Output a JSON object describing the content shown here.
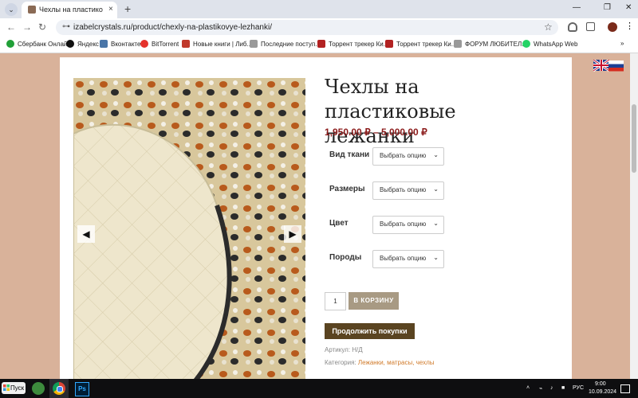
{
  "browser": {
    "tab_title": "Чехлы на пластиковые лежан",
    "url": "izabelcrystals.ru/product/chexly-na-plastikovye-lezhanki/",
    "new_tab": "+",
    "tab_close": "×",
    "tab_list": "⌄"
  },
  "window_controls": {
    "minimize": "—",
    "maximize": "❐",
    "close": "✕"
  },
  "nav": {
    "back": "←",
    "forward": "→",
    "reload": "↻",
    "lock": "⊶",
    "star": "☆"
  },
  "bookmarks": [
    {
      "label": "Сбербанк Онлайн",
      "color": "#21a038"
    },
    {
      "label": "Яндекс",
      "color": "#111111"
    },
    {
      "label": "Вконтакте",
      "color": "#4a76a8"
    },
    {
      "label": "BitTorrent",
      "color": "#e5312b"
    },
    {
      "label": "Новые книги | Либ...",
      "color": "#c0392b"
    },
    {
      "label": "Последние поступ...",
      "color": "#999999"
    },
    {
      "label": "Торрент трекер Ки...",
      "color": "#b22222"
    },
    {
      "label": "Торрент трекер Ки...",
      "color": "#b22222"
    },
    {
      "label": "ФОРУМ ЛЮБИТЕЛ...",
      "color": "#999999"
    },
    {
      "label": "WhatsApp Web",
      "color": "#25d366"
    }
  ],
  "bookmarks_more": "»",
  "product": {
    "title": "Чехлы на пластиковые лежанки",
    "price_range": "1,950.00 ₽ – 5,000.00 ₽",
    "options": [
      {
        "label": "Вид ткани",
        "placeholder": "Выбрать опцию"
      },
      {
        "label": "Размеры",
        "placeholder": "Выбрать опцию"
      },
      {
        "label": "Цвет",
        "placeholder": "Выбрать опцию"
      },
      {
        "label": "Породы",
        "placeholder": "Выбрать опцию"
      }
    ],
    "quantity": "1",
    "add_to_cart": "В КОРЗИНУ",
    "continue_shopping": "Продолжить покупки",
    "sku_label": "Артикул:",
    "sku_value": "Н/Д",
    "category_label": "Категория:",
    "category_value": "Лежанки, матрасы, чехлы"
  },
  "gallery": {
    "prev": "◀",
    "next": "▶"
  },
  "taskbar": {
    "start_label": "Пуск",
    "lang": "РУС",
    "time": "9:00",
    "date": "10.09.2024"
  },
  "colors": {
    "page_bg": "#d9b29a",
    "price": "#8b1a1a",
    "cart_button": "#a89a83",
    "continue_button": "#5a4421",
    "category_link": "#d07a2a"
  }
}
